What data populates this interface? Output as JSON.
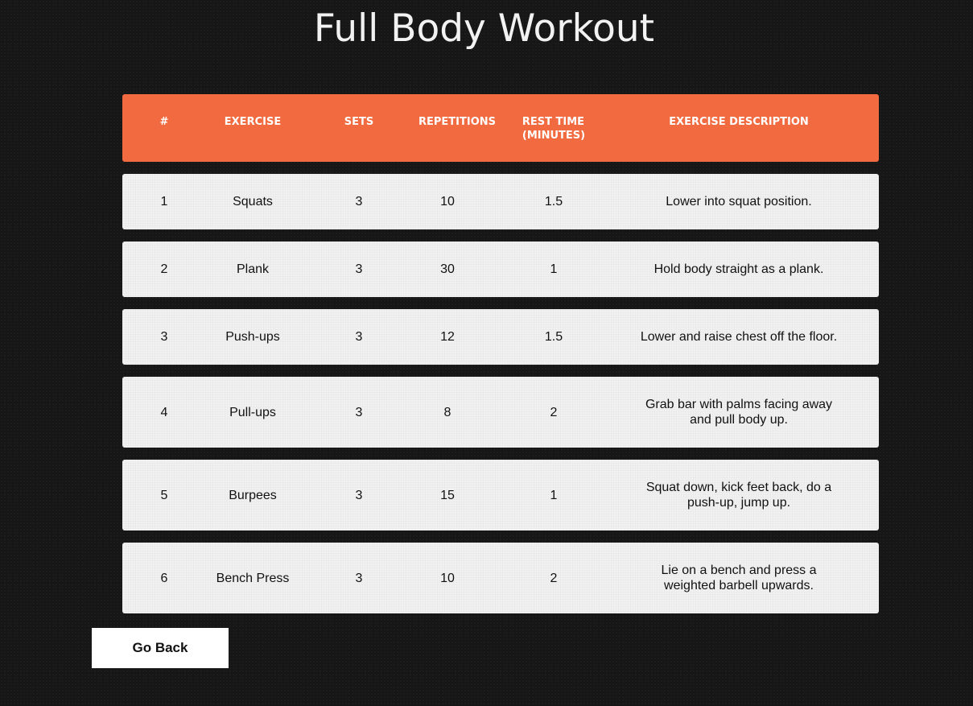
{
  "page": {
    "title": "Full Body Workout"
  },
  "table": {
    "headers": {
      "num": "#",
      "exercise": "EXERCISE",
      "sets": "SETS",
      "repetitions": "REPETITIONS",
      "rest_line1": "REST TIME",
      "rest_line2": "(MINUTES)",
      "description": "EXERCISE DESCRIPTION"
    },
    "rows": [
      {
        "num": "1",
        "exercise": "Squats",
        "sets": "3",
        "reps": "10",
        "rest": "1.5",
        "description": "Lower into squat position."
      },
      {
        "num": "2",
        "exercise": "Plank",
        "sets": "3",
        "reps": "30",
        "rest": "1",
        "description": "Hold body straight as a plank."
      },
      {
        "num": "3",
        "exercise": "Push-ups",
        "sets": "3",
        "reps": "12",
        "rest": "1.5",
        "description": "Lower and raise chest off the floor."
      },
      {
        "num": "4",
        "exercise": "Pull-ups",
        "sets": "3",
        "reps": "8",
        "rest": "2",
        "description": "Grab bar with palms facing away and pull body up."
      },
      {
        "num": "5",
        "exercise": "Burpees",
        "sets": "3",
        "reps": "15",
        "rest": "1",
        "description": "Squat down, kick feet back, do a push-up, jump up."
      },
      {
        "num": "6",
        "exercise": "Bench Press",
        "sets": "3",
        "reps": "10",
        "rest": "2",
        "description": "Lie on a bench and press a weighted barbell upwards."
      }
    ]
  },
  "actions": {
    "go_back_label": "Go Back"
  },
  "colors": {
    "background": "#161616",
    "header_accent": "#f26a3f",
    "row_background": "#f1f1f1",
    "button_background": "#ffffff"
  }
}
